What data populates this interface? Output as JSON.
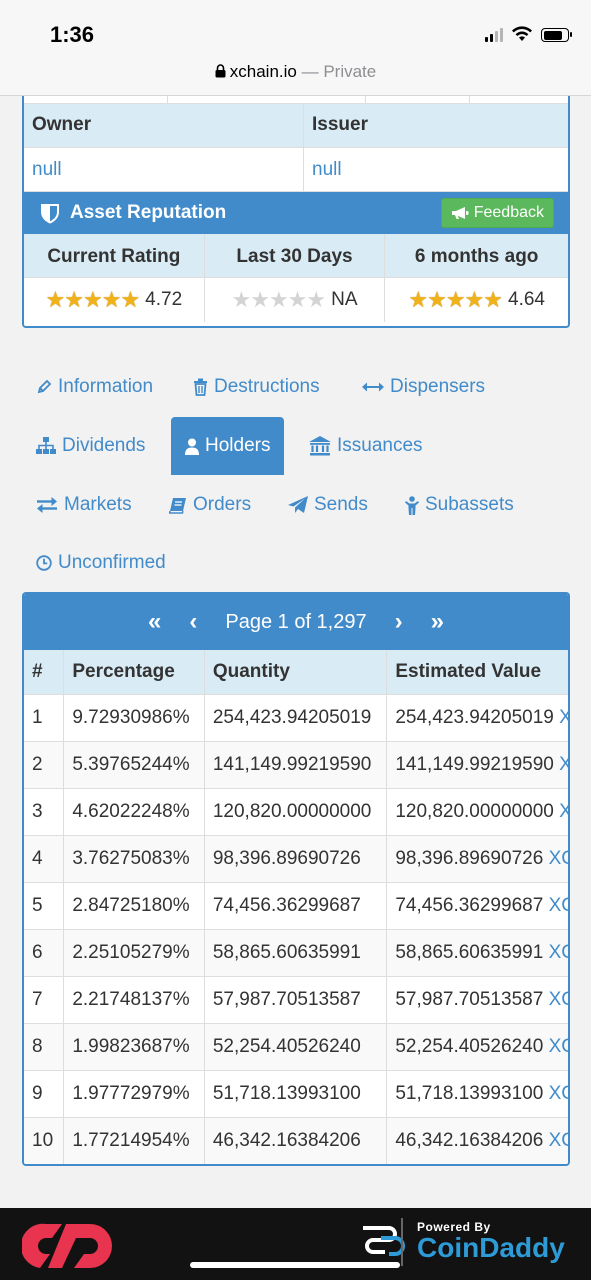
{
  "status_bar": {
    "time": "1:36"
  },
  "browser": {
    "domain": "xchain.io",
    "mode": " — Private"
  },
  "asset_info": {
    "owner_label": "Owner",
    "issuer_label": "Issuer",
    "owner_value": "null",
    "issuer_value": "null"
  },
  "reputation": {
    "title": "Asset Reputation",
    "feedback_label": "Feedback",
    "columns": [
      "Current Rating",
      "Last 30 Days",
      "6 months ago"
    ],
    "ratings": [
      {
        "stars": 4.72,
        "text": "4.72"
      },
      {
        "stars": 0,
        "text": "NA"
      },
      {
        "stars": 4.64,
        "text": "4.64"
      }
    ]
  },
  "tabs": [
    {
      "label": "Information",
      "icon": "pencil-icon",
      "active": false
    },
    {
      "label": "Destructions",
      "icon": "trash-icon",
      "active": false
    },
    {
      "label": "Dispensers",
      "icon": "arrows-h-icon",
      "active": false
    },
    {
      "label": "Dividends",
      "icon": "sitemap-icon",
      "active": false
    },
    {
      "label": "Holders",
      "icon": "user-icon",
      "active": true
    },
    {
      "label": "Issuances",
      "icon": "bank-icon",
      "active": false
    },
    {
      "label": "Markets",
      "icon": "exchange-icon",
      "active": false
    },
    {
      "label": "Orders",
      "icon": "book-icon",
      "active": false
    },
    {
      "label": "Sends",
      "icon": "paper-plane-icon",
      "active": false
    },
    {
      "label": "Subassets",
      "icon": "child-icon",
      "active": false
    },
    {
      "label": "Unconfirmed",
      "icon": "clock-icon",
      "active": false
    }
  ],
  "holders": {
    "page_label": "Page 1 of 1,297",
    "headers": [
      "#",
      "Percentage",
      "Quantity",
      "Estimated Value"
    ],
    "rows": [
      {
        "n": "1",
        "pct": "9.72930986%",
        "qty": "254,423.94205019",
        "val": "254,423.94205019",
        "asset": "X"
      },
      {
        "n": "2",
        "pct": "5.39765244%",
        "qty": "141,149.99219590",
        "val": "141,149.99219590",
        "asset": "X"
      },
      {
        "n": "3",
        "pct": "4.62022248%",
        "qty": "120,820.00000000",
        "val": "120,820.00000000",
        "asset": "X"
      },
      {
        "n": "4",
        "pct": "3.76275083%",
        "qty": "98,396.89690726",
        "val": "98,396.89690726",
        "asset": "XC"
      },
      {
        "n": "5",
        "pct": "2.84725180%",
        "qty": "74,456.36299687",
        "val": "74,456.36299687",
        "asset": "XC"
      },
      {
        "n": "6",
        "pct": "2.25105279%",
        "qty": "58,865.60635991",
        "val": "58,865.60635991",
        "asset": "XC"
      },
      {
        "n": "7",
        "pct": "2.21748137%",
        "qty": "57,987.70513587",
        "val": "57,987.70513587",
        "asset": "XC"
      },
      {
        "n": "8",
        "pct": "1.99823687%",
        "qty": "52,254.40526240",
        "val": "52,254.40526240",
        "asset": "XC"
      },
      {
        "n": "9",
        "pct": "1.97772979%",
        "qty": "51,718.13993100",
        "val": "51,718.13993100",
        "asset": "XC"
      },
      {
        "n": "10",
        "pct": "1.77214954%",
        "qty": "46,342.16384206",
        "val": "46,342.16384206",
        "asset": "XC"
      }
    ]
  },
  "ad": {
    "powered_by": "Powered By",
    "brand": "CoinDaddy"
  },
  "colors": {
    "primary": "#428bca",
    "header_bg": "#d9ecf5",
    "success": "#5cb85c",
    "star": "#f0b21b",
    "ad_brand": "#2e9bd6"
  }
}
